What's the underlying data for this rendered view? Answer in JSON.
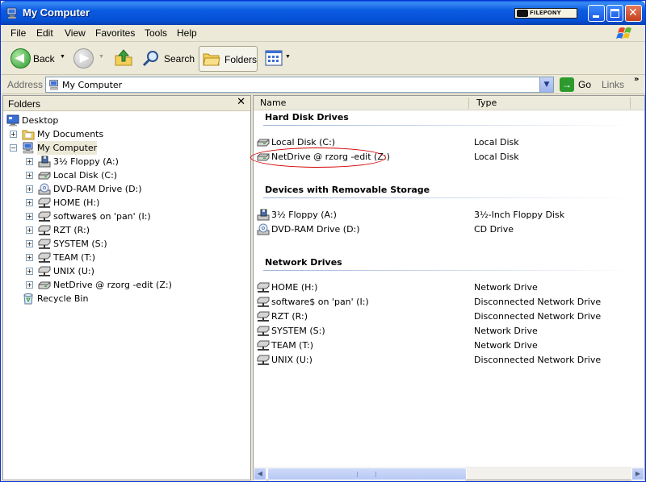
{
  "window": {
    "title": "My Computer",
    "brand_badge": "FILEPONY"
  },
  "menu": [
    "File",
    "Edit",
    "View",
    "Favorites",
    "Tools",
    "Help"
  ],
  "toolbar": {
    "back": "Back",
    "search": "Search",
    "folders": "Folders"
  },
  "address": {
    "label": "Address",
    "value": "My Computer",
    "go": "Go",
    "links": "Links"
  },
  "folders_pane": {
    "title": "Folders",
    "tree": [
      {
        "label": "Desktop",
        "icon": "desktop-icon",
        "level": 0,
        "expander": ""
      },
      {
        "label": "My Documents",
        "icon": "folder-icon",
        "level": 1,
        "expander": "+"
      },
      {
        "label": "My Computer",
        "icon": "computer-icon",
        "level": 1,
        "expander": "−",
        "selected": true
      },
      {
        "label": "3½ Floppy (A:)",
        "icon": "floppy-icon",
        "level": 2,
        "expander": "+"
      },
      {
        "label": "Local Disk (C:)",
        "icon": "drive-icon",
        "level": 2,
        "expander": "+"
      },
      {
        "label": "DVD-RAM Drive (D:)",
        "icon": "cd-icon",
        "level": 2,
        "expander": "+"
      },
      {
        "label": "HOME (H:)",
        "icon": "network-drive-icon",
        "level": 2,
        "expander": "+"
      },
      {
        "label": "software$ on 'pan' (I:)",
        "icon": "network-drive-icon",
        "level": 2,
        "expander": "+"
      },
      {
        "label": "RZT (R:)",
        "icon": "network-drive-icon",
        "level": 2,
        "expander": "+"
      },
      {
        "label": "SYSTEM (S:)",
        "icon": "network-drive-icon",
        "level": 2,
        "expander": "+"
      },
      {
        "label": "TEAM (T:)",
        "icon": "network-drive-icon",
        "level": 2,
        "expander": "+"
      },
      {
        "label": "UNIX (U:)",
        "icon": "network-drive-icon",
        "level": 2,
        "expander": "+"
      },
      {
        "label": "NetDrive @ rzorg -edit (Z:)",
        "icon": "drive-icon",
        "level": 2,
        "expander": "+"
      },
      {
        "label": "Recycle Bin",
        "icon": "recycle-bin-icon",
        "level": 1,
        "expander": ""
      }
    ]
  },
  "list": {
    "columns": {
      "name": "Name",
      "type": "Type"
    },
    "groups": [
      {
        "title": "Hard Disk Drives",
        "items": [
          {
            "name": "Local Disk (C:)",
            "type": "Local Disk",
            "icon": "drive-icon"
          },
          {
            "name": "NetDrive @ rzorg -edit (Z:)",
            "type": "Local Disk",
            "icon": "drive-icon"
          }
        ]
      },
      {
        "title": "Devices with Removable Storage",
        "items": [
          {
            "name": "3½ Floppy (A:)",
            "type": "3½-Inch Floppy Disk",
            "icon": "floppy-icon"
          },
          {
            "name": "DVD-RAM Drive (D:)",
            "type": "CD Drive",
            "icon": "cd-icon"
          }
        ]
      },
      {
        "title": "Network Drives",
        "items": [
          {
            "name": "HOME (H:)",
            "type": "Network Drive",
            "icon": "network-drive-icon"
          },
          {
            "name": "software$ on 'pan' (I:)",
            "type": "Disconnected Network Drive",
            "icon": "network-drive-icon"
          },
          {
            "name": "RZT (R:)",
            "type": "Disconnected Network Drive",
            "icon": "network-drive-icon"
          },
          {
            "name": "SYSTEM (S:)",
            "type": "Network Drive",
            "icon": "network-drive-icon"
          },
          {
            "name": "TEAM (T:)",
            "type": "Network Drive",
            "icon": "network-drive-icon"
          },
          {
            "name": "UNIX (U:)",
            "type": "Disconnected Network Drive",
            "icon": "network-drive-icon"
          }
        ]
      }
    ]
  },
  "colors": {
    "titlebar": "#0553d6",
    "highlight_ellipse": "#d40000",
    "selection": "#ece9d8"
  }
}
